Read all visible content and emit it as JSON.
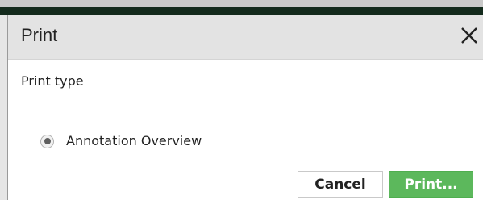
{
  "dialog": {
    "title": "Print",
    "close_icon": "close-icon",
    "section_label": "Print type",
    "options": [
      {
        "label": "Annotation Overview",
        "selected": true
      }
    ],
    "buttons": {
      "cancel": "Cancel",
      "print": "Print..."
    }
  },
  "colors": {
    "header_bg": "#e3e3e3",
    "top_bar": "#132a1c",
    "print_button": "#5cb85c"
  }
}
